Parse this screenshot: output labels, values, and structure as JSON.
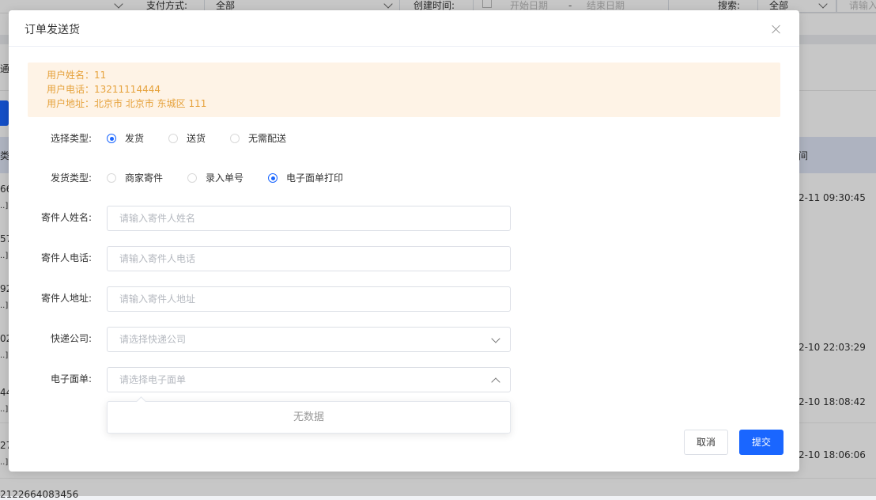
{
  "background": {
    "filter": {
      "payment_label": "支付方式:",
      "payment_value": "全部",
      "created_label": "创建时间:",
      "start_placeholder": "开始日期",
      "range_sep": "-",
      "end_placeholder": "结束日期",
      "search_label": "搜索:",
      "search_scope": "全部",
      "search_placeholder": "请输入"
    },
    "tab_fragment": "通",
    "table_header_fragment": "间",
    "left_fragment_header": "类",
    "rows": [
      {
        "left_top": "66",
        "left_bottom": "..]",
        "time": "2-11 09:30:45"
      },
      {
        "left_top": "57",
        "left_bottom": "..]",
        "time": ""
      },
      {
        "left_top": "92",
        "left_bottom": "..]",
        "time": ""
      },
      {
        "left_top": "02",
        "left_bottom": "..]",
        "time": "2-10 22:03:29"
      },
      {
        "left_top": "44",
        "left_bottom": "..]",
        "time": "2-10 18:08:42"
      },
      {
        "left_top": "27",
        "left_bottom": "..]",
        "time": "2-10 18:06:06"
      }
    ],
    "bottom_fragment": "2122664083456"
  },
  "dialog": {
    "title": "订单发送货",
    "user_info": {
      "name": "用户姓名：11",
      "phone": "用户电话：13211114444",
      "address": "用户地址：北京市 北京市 东城区 111"
    },
    "select_type": {
      "label": "选择类型:",
      "options": [
        "发货",
        "送货",
        "无需配送"
      ],
      "selected": "发货"
    },
    "ship_type": {
      "label": "发货类型:",
      "options": [
        "商家寄件",
        "录入单号",
        "电子面单打印"
      ],
      "selected": "电子面单打印"
    },
    "sender_name": {
      "label": "寄件人姓名:",
      "placeholder": "请输入寄件人姓名"
    },
    "sender_phone": {
      "label": "寄件人电话:",
      "placeholder": "请输入寄件人电话"
    },
    "sender_address": {
      "label": "寄件人地址:",
      "placeholder": "请输入寄件人地址"
    },
    "courier": {
      "label": "快递公司:",
      "placeholder": "请选择快递公司"
    },
    "waybill": {
      "label": "电子面单:",
      "placeholder": "请选择电子面单",
      "empty_text": "无数据"
    },
    "buttons": {
      "cancel": "取消",
      "submit": "提交"
    }
  },
  "colors": {
    "primary": "#1a66ff",
    "warning_text": "#e6a23c",
    "warning_bg": "#fef3e6"
  },
  "icons": [
    "close-icon",
    "chevron-down-icon",
    "chevron-up-icon",
    "calendar-icon"
  ]
}
